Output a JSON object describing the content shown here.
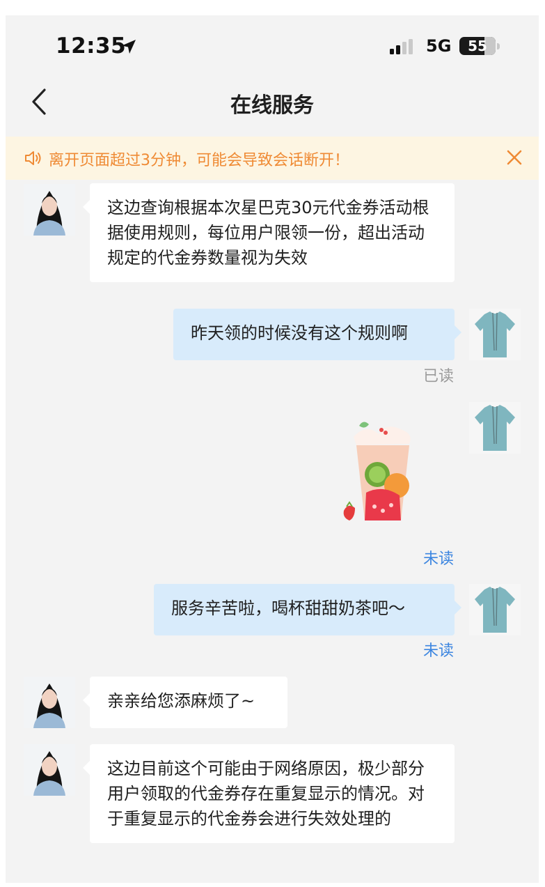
{
  "status_bar": {
    "time": "12:35",
    "network": "5G",
    "battery": "55"
  },
  "nav": {
    "title": "在线服务"
  },
  "notice": {
    "text": "离开页面超过3分钟，可能会导致会话断开！"
  },
  "messages": [
    {
      "from": "agent",
      "text": "这边查询根据本次星巴克30元代金券活动根据使用规则，每位用户限领一份，超出活动规定的代金券数量视为失效"
    },
    {
      "from": "user",
      "text": "昨天领的时候没有这个规则啊",
      "status": "已读"
    },
    {
      "from": "user",
      "type": "sticker",
      "icon": "milk-tea-sticker",
      "status": "未读"
    },
    {
      "from": "user",
      "text": "服务辛苦啦，喝杯甜甜奶茶吧～",
      "status": "未读"
    },
    {
      "from": "agent",
      "text": "亲亲给您添麻烦了~"
    },
    {
      "from": "agent",
      "text": "这边目前这个可能由于网络原因，极少部分用户领取的代金券存在重复显示的情况。对于重复显示的代金券会进行失效处理的"
    }
  ],
  "colors": {
    "notice_bg": "#fdf5e2",
    "notice_text": "#ef8a34",
    "user_bubble": "#d8ebfb",
    "unread": "#3d86e0"
  }
}
